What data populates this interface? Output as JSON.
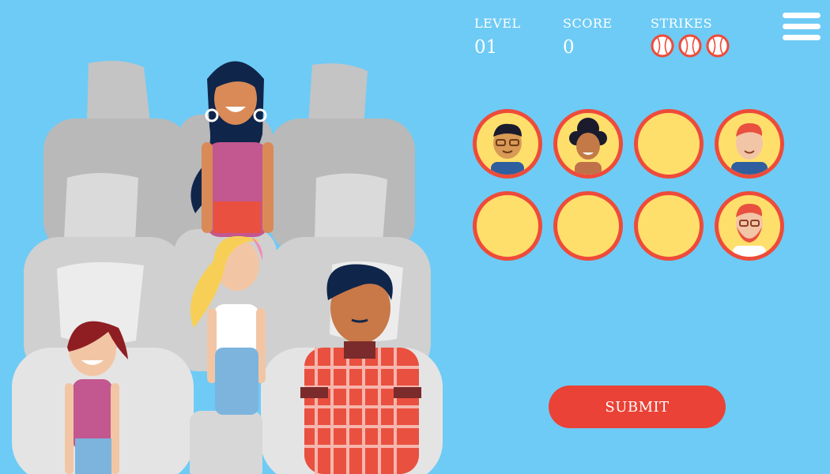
{
  "hud": {
    "level_label": "LEVEL",
    "level_value": "01",
    "score_label": "SCORE",
    "score_value": "0",
    "strikes_label": "STRIKES",
    "strikes_remaining": 3
  },
  "answer_slots": [
    {
      "index": 1,
      "state": "filled",
      "character": "man-with-glasses-black-hair"
    },
    {
      "index": 2,
      "state": "filled",
      "character": "woman-with-curly-hair"
    },
    {
      "index": 3,
      "state": "empty"
    },
    {
      "index": 4,
      "state": "filled",
      "character": "red-haired-man"
    },
    {
      "index": 5,
      "state": "empty"
    },
    {
      "index": 6,
      "state": "empty"
    },
    {
      "index": 7,
      "state": "empty"
    },
    {
      "index": 8,
      "state": "filled",
      "character": "red-bearded-man-with-glasses"
    }
  ],
  "submit_label": "SUBMIT",
  "colors": {
    "background": "#6ecbf5",
    "slot_fill": "#ffdf6b",
    "slot_ring": "#ee4b3a",
    "submit": "#ea4236",
    "text": "#ffffff"
  },
  "icons": {
    "menu": "hamburger-menu-icon",
    "strike": "baseball-icon"
  }
}
